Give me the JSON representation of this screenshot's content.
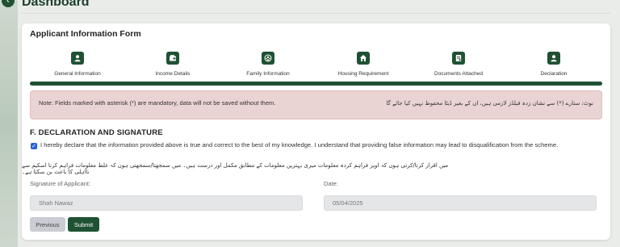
{
  "header": {
    "back_icon": "chevron-left-icon",
    "title": "Dashboard"
  },
  "form": {
    "title": "Applicant Information Form",
    "steps": [
      {
        "label": "General Information",
        "icon": "user-icon"
      },
      {
        "label": "Income Details",
        "icon": "wallet-icon"
      },
      {
        "label": "Family Information",
        "icon": "family-icon"
      },
      {
        "label": "Housing Requirement",
        "icon": "home-icon"
      },
      {
        "label": "Documents Attached",
        "icon": "document-icon"
      },
      {
        "label": "Declaration",
        "icon": "user-icon"
      }
    ],
    "progress_fraction": 1.0,
    "note_en": "Note: Fields marked with asterisk (*) are mandatory, data will not be saved without them.",
    "note_ur": "نوٹ: ستارے (*) سے نشان زدہ فیلڈز لازمی ہیں، ان کے بغیر ڈیٹا محفوظ نہیں کیا جائے گا",
    "section_title": "F. DECLARATION AND SIGNATURE",
    "declaration_checked": true,
    "declaration_en": "I hereby declare that the information provided above is true and correct to the best of my knowledge. I understand that providing false information may lead to disqualification from the scheme.",
    "declaration_ur": "میں اقرار کرتا/کرتی ہوں کہ اوپر فراہم کردہ معلومات میری بہترین معلومات کے مطابق مکمل اور درست ہیں۔ میں سمجھتا/سمجھتی ہوں کہ غلط معلومات فراہم کرنا اسکیم سے نااہلی کا باعث بن سکتا ہے۔",
    "signature_label": "Signature of Applicant:",
    "signature_value": "Shah Nawaz",
    "date_label": "Date:",
    "date_value": "05/04/2025",
    "previous_label": "Previous",
    "submit_label": "Submit"
  },
  "colors": {
    "primary": "#1f5133",
    "note_bg": "#ead3d3",
    "checkbox": "#2a62d8"
  }
}
